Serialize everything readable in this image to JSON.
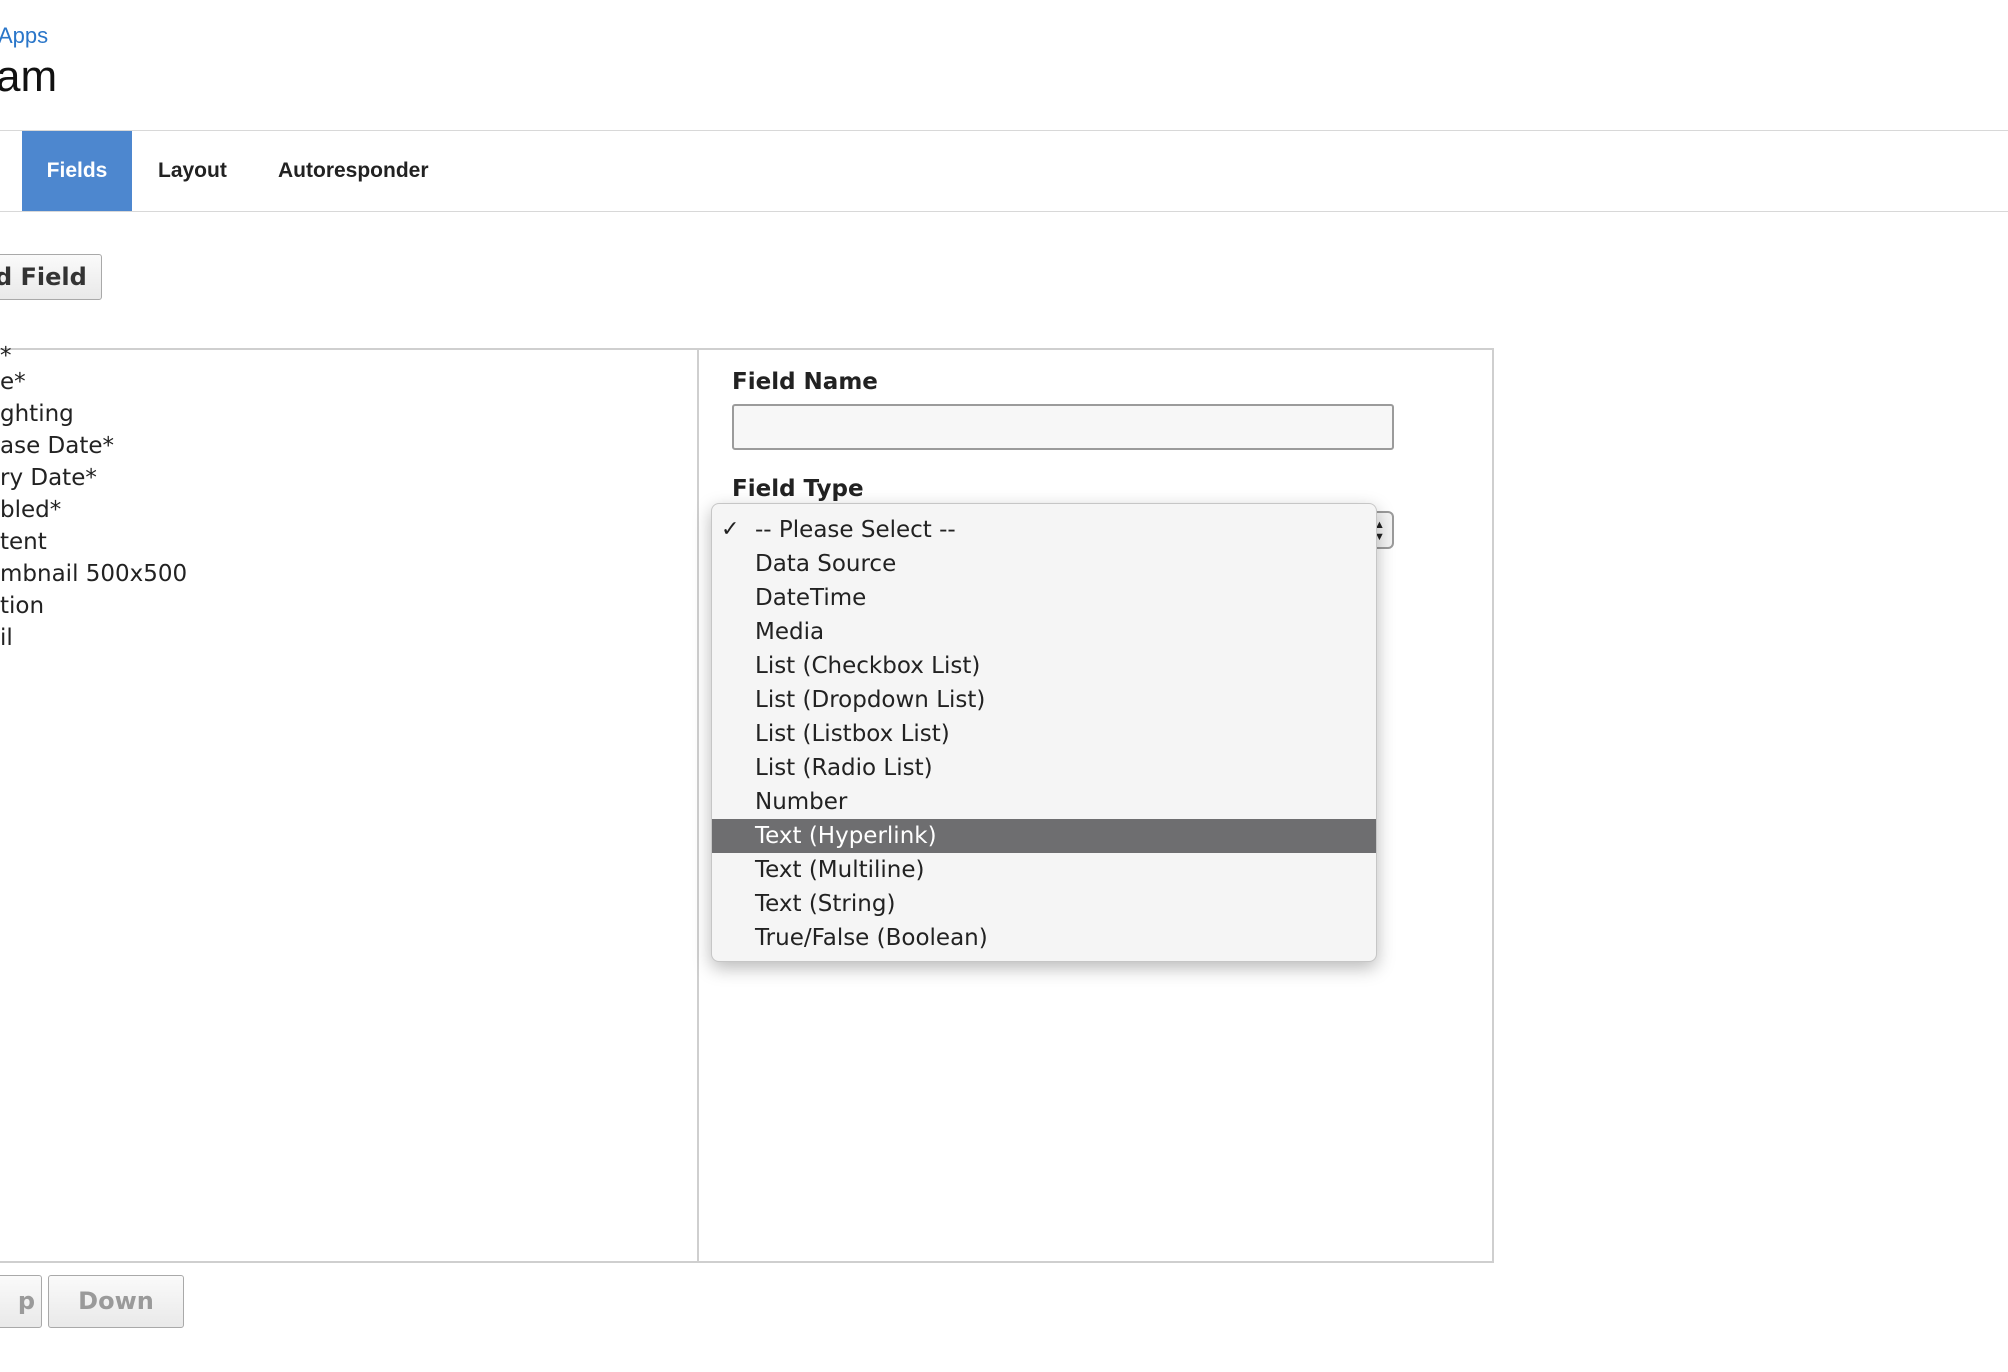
{
  "breadcrumb": "Apps",
  "page_title": "am",
  "tabs": [
    {
      "label": "Fields",
      "active": true
    },
    {
      "label": "Layout",
      "active": false
    },
    {
      "label": "Autoresponder",
      "active": false
    }
  ],
  "add_field_label": "d Field",
  "field_list": [
    "*",
    "e*",
    "ghting",
    "ase Date*",
    "ry Date*",
    "bled*",
    "tent",
    "mbnail 500x500",
    "tion",
    "il"
  ],
  "form": {
    "field_name_label": "Field Name",
    "field_name_value": "",
    "field_type_label": "Field Type"
  },
  "dropdown": {
    "selected": "-- Please Select --",
    "highlighted": "Text (Hyperlink)",
    "options": [
      "-- Please Select --",
      "Data Source",
      "DateTime",
      "Media",
      "List (Checkbox List)",
      "List (Dropdown List)",
      "List (Listbox List)",
      "List (Radio List)",
      "Number",
      "Text (Hyperlink)",
      "Text (Multiline)",
      "Text (String)",
      "True/False (Boolean)"
    ]
  },
  "move_buttons": {
    "up_label": "p",
    "down_label": "Down"
  },
  "colors": {
    "accent": "#4d87cf",
    "link": "#2a76c9",
    "highlight": "#6e6e70"
  },
  "icons": {
    "check": "checkmark-icon",
    "select_arrows": "select-arrows-icon"
  }
}
